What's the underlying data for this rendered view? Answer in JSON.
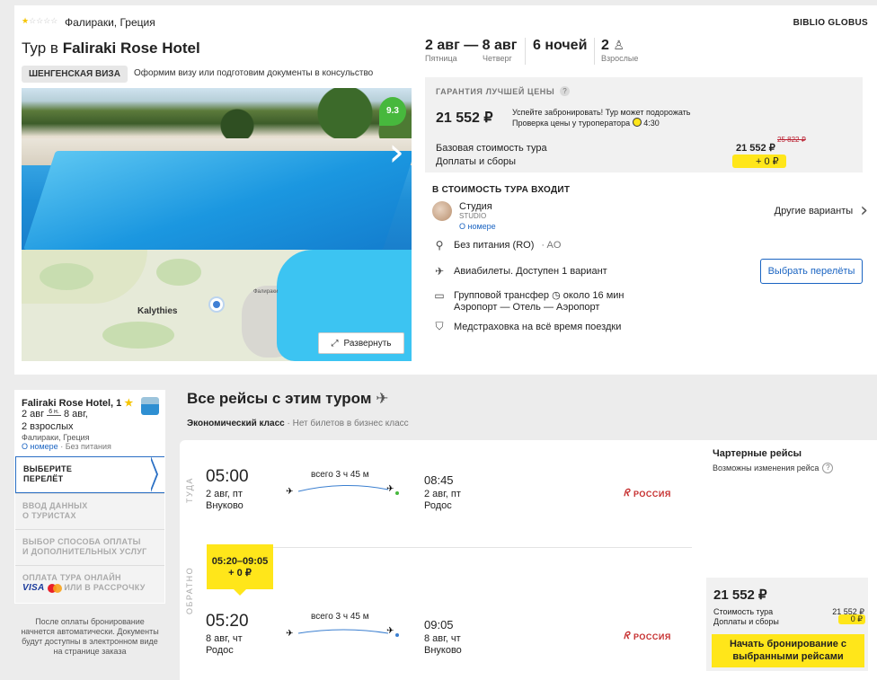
{
  "hotel": {
    "stars_filled": 1,
    "stars_total": 5,
    "location": "Фалираки, Греция",
    "operator": "BIBLIO GLOBUS",
    "title_prefix": "Тур в",
    "title_name": "Faliraki Rose Hotel",
    "visa_badge": "ШЕНГЕНСКАЯ ВИЗА",
    "visa_note": "Оформим визу или подготовим документы в консульство",
    "rating": "9.3",
    "map_place": "Kalythies",
    "map_place2": "Фалираки",
    "expand_label": "Развернуть"
  },
  "trip": {
    "dates": "2 авг — 8 авг",
    "day_from": "Пятница",
    "day_to": "Четверг",
    "nights": "6 ночей",
    "adults_count": "2",
    "adults_label": "Взрослые"
  },
  "price_guarantee": {
    "title": "ГАРАНТИЯ ЛУЧШЕЙ ЦЕНЫ",
    "q": "?",
    "price": "21 552 ₽",
    "note1": "Успейте забронировать! Тур может подорожать",
    "note2": "Проверка цены у туроператора",
    "timer": "4:30",
    "base_label": "Базовая стоимость тура",
    "base_value": "21 552 ₽",
    "old_value": "25 822 ₽",
    "fees_label": "Доплаты и сборы",
    "fees_value": "+ 0 ₽"
  },
  "includes": {
    "title": "В СТОИМОСТЬ ТУРА ВХОДИТ",
    "room_name": "Студия",
    "room_code": "STUDIO",
    "room_link": "О номере",
    "other_variants": "Другие варианты",
    "meal": "Без питания (RO)",
    "meal_code": "· AO",
    "flights": "Авиабилеты. Доступен 1 вариант",
    "flights_button": "Выбрать перелёты",
    "transfer": "Групповой трансфер",
    "transfer_time": "около 16 мин",
    "transfer_route": "Аэропорт — Отель — Аэропорт",
    "insurance": "Медстраховка на всё время поездки"
  },
  "sidebar": {
    "hotel": "Faliraki Rose Hotel, 1",
    "date_from": "2 авг",
    "nights_short": "6 н.",
    "date_to": "8 авг,",
    "adults": "2 взрослых",
    "location": "Фалираки, Греция",
    "room_link": "О номере",
    "meal": "· Без питания",
    "steps": [
      {
        "line1": "ВЫБЕРИТЕ",
        "line2": "ПЕРЕЛЁТ"
      },
      {
        "line1": "ВВОД ДАННЫХ",
        "line2": "О ТУРИСТАХ"
      },
      {
        "line1": "ВЫБОР СПОСОБА ОПЛАТЫ",
        "line2": "И ДОПОЛНИТЕЛЬНЫХ УСЛУГ"
      },
      {
        "line1": "ОПЛАТА ТУРА ОНЛАЙН",
        "line2": "ИЛИ В РАССРОЧКУ"
      }
    ],
    "visa_logo": "VISA",
    "note": "После оплаты бронирование начнется автоматически. Документы будут доступны в электронном виде на странице заказа"
  },
  "flights": {
    "title": "Все рейсы с этим туром",
    "class_label": "Экономический класс",
    "class_note": "· Нет билетов в бизнес класс",
    "charter_title": "Чартерные рейсы",
    "charter_note": "Возможны изменения рейса",
    "q": "?",
    "outbound": {
      "label": "ТУДА",
      "dep_time": "05:00",
      "dep_date": "2 авг, пт",
      "dep_airport": "Внуково",
      "duration": "всего 3 ч 45 м",
      "arr_time": "08:45",
      "arr_date": "2 авг, пт",
      "arr_airport": "Родос",
      "airline": "РОССИЯ"
    },
    "inbound": {
      "label": "ОБРАТНО",
      "chip_time": "05:20–09:05",
      "chip_price": "+ 0 ₽",
      "dep_time": "05:20",
      "dep_date": "8 авг, чт",
      "dep_airport": "Родос",
      "duration": "всего 3 ч 45 м",
      "arr_time": "09:05",
      "arr_date": "8 авг, чт",
      "arr_airport": "Внуково",
      "airline": "РОССИЯ"
    },
    "summary": {
      "price": "21 552 ₽",
      "cost_label": "Стоимость тура",
      "cost_value": "21 552 ₽",
      "fees_label": "Доплаты и сборы",
      "fees_value": "0 ₽",
      "button": "Начать бронирование с выбранными рейсами"
    }
  },
  "colors": {
    "accent_yellow": "#ffe61a",
    "link_blue": "#1a64c2",
    "rating_green": "#47b83d",
    "airline_red": "#c52b2b"
  }
}
